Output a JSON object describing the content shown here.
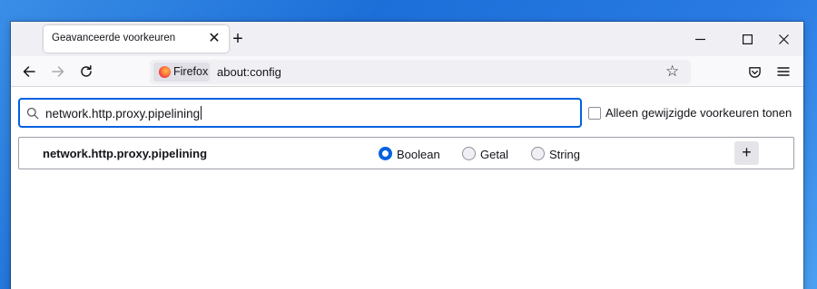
{
  "tabs": [
    {
      "title": "Geavanceerde voorkeuren",
      "close_icon": "close-icon"
    }
  ],
  "tabstrip": {
    "new_tab_symbol": "+",
    "window_controls": [
      "minimize-icon",
      "maximize-icon",
      "close-icon"
    ]
  },
  "navbar": {
    "buttons": [
      "back-icon",
      "forward-icon",
      "reload-icon"
    ],
    "identity_label": "Firefox",
    "url": "about:config",
    "right_icons": [
      "bookmark-star-icon",
      "pocket-icon",
      "menu-icon"
    ]
  },
  "search": {
    "value": "network.http.proxy.pipelining",
    "icon": "search-icon"
  },
  "filter": {
    "label": "Alleen gewijzigde voorkeuren tonen",
    "checked": false
  },
  "new_pref": {
    "name": "network.http.proxy.pipelining",
    "types": [
      {
        "label": "Boolean",
        "selected": true
      },
      {
        "label": "Getal",
        "selected": false
      },
      {
        "label": "String",
        "selected": false
      }
    ],
    "add_symbol": "+"
  },
  "colors": {
    "accent": "#0061e0",
    "toolbar": "#f9f9fb",
    "tabstrip": "#f0f0f4",
    "text": "#15141a"
  }
}
